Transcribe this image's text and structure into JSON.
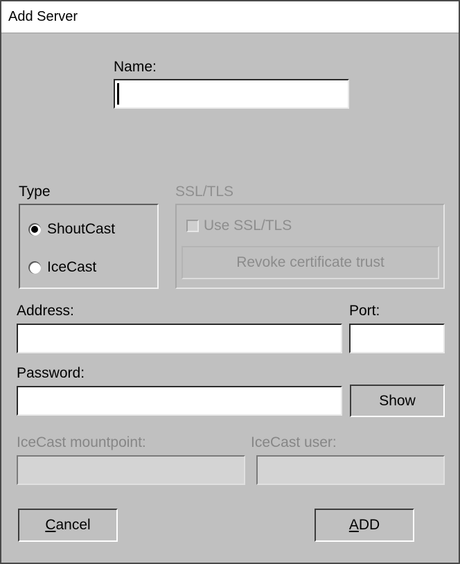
{
  "window": {
    "title": "Add Server"
  },
  "fields": {
    "name": {
      "label": "Name:",
      "value": "",
      "placeholder": ""
    },
    "address": {
      "label": "Address:",
      "value": "",
      "placeholder": ""
    },
    "port": {
      "label": "Port:",
      "value": "",
      "placeholder": ""
    },
    "password": {
      "label": "Password:",
      "value": "",
      "placeholder": ""
    },
    "mountpoint": {
      "label": "IceCast mountpoint:",
      "value": "",
      "placeholder": "",
      "enabled": false
    },
    "user": {
      "label": "IceCast user:",
      "value": "",
      "placeholder": "",
      "enabled": false
    }
  },
  "type_group": {
    "title": "Type",
    "options": [
      {
        "label": "ShoutCast",
        "selected": true
      },
      {
        "label": "IceCast",
        "selected": false
      }
    ]
  },
  "ssl_group": {
    "title": "SSL/TLS",
    "enabled": false,
    "checkbox": {
      "label": "Use SSL/TLS",
      "checked": false
    },
    "revoke_button": {
      "label": "Revoke certificate trust",
      "enabled": false
    }
  },
  "buttons": {
    "show": {
      "label": "Show"
    },
    "cancel": {
      "mnemonic": "C",
      "rest": "ancel"
    },
    "add": {
      "mnemonic": "A",
      "rest": "DD"
    }
  },
  "colors": {
    "dialog_background": "#c0c0c0",
    "titlebar_background": "#ffffff",
    "field_background": "#ffffff",
    "disabled_field_background": "#d4d4d4",
    "text": "#000000",
    "disabled_text": "#8b8b8b"
  }
}
